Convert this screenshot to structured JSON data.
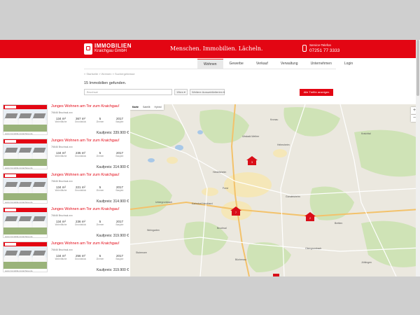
{
  "header": {
    "logo_line1": "IMMOBILIEN",
    "logo_line2": "Kraichgau GmbH",
    "slogan": "Menschen. Immobilien. Lächeln.",
    "contact_label": "Service-Telefon",
    "contact_number": "07251 77 3333",
    "brand_color": "#e30613"
  },
  "nav": {
    "items": [
      {
        "label": "Wohnen",
        "active": true
      },
      {
        "label": "Gewerbe",
        "active": false
      },
      {
        "label": "Verkauf",
        "active": false
      },
      {
        "label": "Verwaltung",
        "active": false
      },
      {
        "label": "Unternehmen",
        "active": false
      },
      {
        "label": "Login",
        "active": false
      }
    ]
  },
  "breadcrumb": "» Startseite » Wohnen » Suchergebnisse",
  "results_text": "15 Immobilien gefunden.",
  "search": {
    "value": "Bruchsal",
    "radius_label": "15km ▾",
    "more_label": "Weitere Auswahlkriterien ▾",
    "filter_button": "Alle Treffer anzeigen"
  },
  "listings": [
    {
      "title": "Junges Wohnen am Tor zum Kraichgau!",
      "location": "76646 Bruchsal-xxx",
      "living_area": "134 m²",
      "plot_area": "367 m²",
      "rooms": "5",
      "year": "2017",
      "price": "Kaufpreis: 339.900 €",
      "thumb_caption": "www.immobilien-kraichgau.de"
    },
    {
      "title": "Junges Wohnen am Tor zum Kraichgau!",
      "location": "76646 Bruchsal-xxx",
      "living_area": "134 m²",
      "plot_area": "235 m²",
      "rooms": "5",
      "year": "2017",
      "price": "Kaufpreis: 314.900 €",
      "thumb_caption": "www.immobilien-kraichgau.de"
    },
    {
      "title": "Junges Wohnen am Tor zum Kraichgau!",
      "location": "76646 Bruchsal-xxx",
      "living_area": "134 m²",
      "plot_area": "221 m²",
      "rooms": "5",
      "year": "2017",
      "price": "Kaufpreis: 314.900 €",
      "thumb_caption": "www.immobilien-kraichgau.de"
    },
    {
      "title": "Junges Wohnen am Tor zum Kraichgau!",
      "location": "76646 Bruchsal-xxx",
      "living_area": "134 m²",
      "plot_area": "236 m²",
      "rooms": "5",
      "year": "2017",
      "price": "Kaufpreis: 319.900 €",
      "thumb_caption": "www.immobilien-kraichgau.de"
    },
    {
      "title": "Junges Wohnen am Tor zum Kraichgau!",
      "location": "76646 Bruchsal-xxx",
      "living_area": "134 m²",
      "plot_area": "256 m²",
      "rooms": "5",
      "year": "2017",
      "price": "Kaufpreis: 319.900 €",
      "thumb_caption": "www.immobilien-kraichgau.de"
    }
  ],
  "fact_labels": {
    "living": "Wohnfläche",
    "plot": "Grundstück",
    "rooms": "Zimmer",
    "year": "Baujahr"
  },
  "map": {
    "type_map": "Karte",
    "type_satellite": "Satellit",
    "type_hybrid": "Hybrid",
    "zoom_in": "+",
    "zoom_out": "−",
    "pins": [
      {
        "label": "3"
      },
      {
        "label": "7"
      },
      {
        "label": "2"
      }
    ],
    "towns": [
      "Heidelsheim",
      "Untergrombach",
      "Weingarten",
      "Helmsheim",
      "Bruchsal",
      "Karlsdorf-Neuthard",
      "Gondelsheim",
      "Bretten",
      "Kraichtal",
      "Ubstadt-Weiher",
      "Forst",
      "Kronau",
      "Stutensee",
      "Büchenau",
      "Obergrombach",
      "Jöhlingen"
    ]
  }
}
